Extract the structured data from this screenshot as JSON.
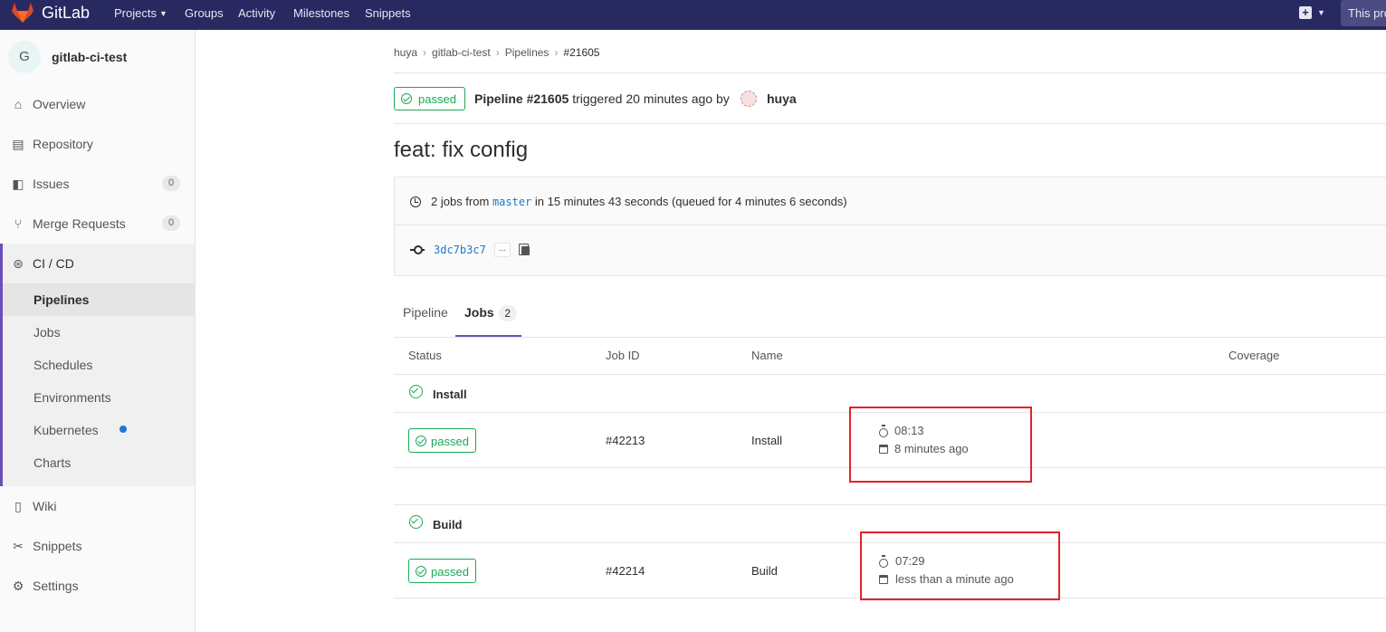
{
  "navbar": {
    "brand": "GitLab",
    "items": [
      "Projects",
      "Groups",
      "Activity",
      "Milestones",
      "Snippets"
    ],
    "search_placeholder": "This pro"
  },
  "sidebar": {
    "project_initial": "G",
    "project_name": "gitlab-ci-test",
    "items": [
      {
        "label": "Overview"
      },
      {
        "label": "Repository"
      },
      {
        "label": "Issues",
        "badge": "0"
      },
      {
        "label": "Merge Requests",
        "badge": "0"
      },
      {
        "label": "CI / CD"
      },
      {
        "label": "Wiki"
      },
      {
        "label": "Snippets"
      },
      {
        "label": "Settings"
      }
    ],
    "ci_sub_items": [
      "Pipelines",
      "Jobs",
      "Schedules",
      "Environments",
      "Kubernetes",
      "Charts"
    ]
  },
  "breadcrumb": [
    "huya",
    "gitlab-ci-test",
    "Pipelines",
    "#21605"
  ],
  "pipeline": {
    "status": "passed",
    "title": "Pipeline #21605",
    "triggered_text": "triggered 20 minutes ago by",
    "user": "huya",
    "commit_title": "feat: fix config",
    "jobs_summary_prefix": "2 jobs from",
    "branch": "master",
    "jobs_summary_suffix": "in 15 minutes 43 seconds (queued for 4 minutes 6 seconds)",
    "sha": "3dc7b3c7",
    "ellipsis": "..."
  },
  "tabs": {
    "pipeline": "Pipeline",
    "jobs": "Jobs",
    "jobs_count": "2"
  },
  "table": {
    "headers": [
      "Status",
      "Job ID",
      "Name",
      "Coverage"
    ],
    "stages": [
      {
        "name": "Install",
        "job": {
          "status": "passed",
          "id": "#42213",
          "name": "Install",
          "duration": "08:13",
          "finished": "8 minutes ago"
        }
      },
      {
        "name": "Build",
        "job": {
          "status": "passed",
          "id": "#42214",
          "name": "Build",
          "duration": "07:29",
          "finished": "less than a minute ago"
        }
      }
    ]
  },
  "colors": {
    "navbar": "#292961",
    "success": "#1aaa55",
    "accent": "#6b4fbb",
    "highlight_box": "#e3222b",
    "link": "#1f78d1"
  }
}
